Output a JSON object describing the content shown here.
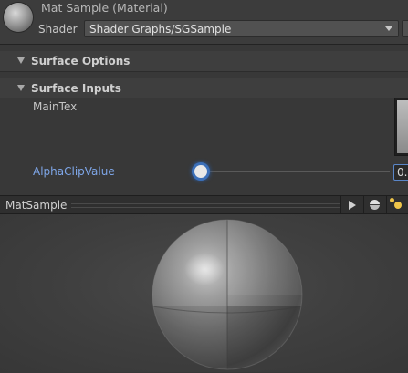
{
  "header": {
    "title": "Mat Sample (Material)",
    "shader_label": "Shader",
    "shader_value": "Shader Graphs/SGSample",
    "material_icon": "material-sphere-icon",
    "dropdown_icon": "chevron-down-icon"
  },
  "sections": [
    {
      "label": "Surface Options",
      "expanded": false
    },
    {
      "label": "Surface Inputs",
      "expanded": true
    }
  ],
  "properties": {
    "main_tex_label": "MainTex",
    "alpha_clip_label": "AlphaClipValue",
    "alpha_clip_value": "0.",
    "alpha_clip_slider_fraction": 0.0
  },
  "preview": {
    "title": "MatSample",
    "buttons": [
      "play-icon",
      "preview-shape-sphere-icon",
      "preview-lights-icon"
    ]
  },
  "colors": {
    "background": "#383838",
    "accent_blue": "#7ea6e8",
    "slider_highlight": "#3b6fb8",
    "light_icon": "#f0c64a"
  }
}
